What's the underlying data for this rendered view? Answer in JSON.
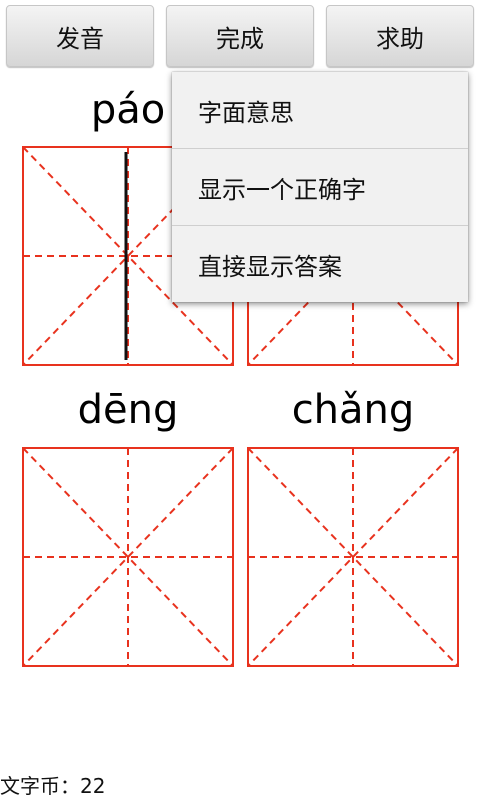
{
  "toolbar": {
    "pronounce_label": "发音",
    "done_label": "完成",
    "help_label": "求助"
  },
  "grid": {
    "cells": [
      {
        "pinyin": "páo"
      },
      {
        "pinyin": ""
      },
      {
        "pinyin": "dēng"
      },
      {
        "pinyin": "chǎng"
      }
    ],
    "guide_color": "#e8321e",
    "stroke_color": "#111111"
  },
  "help_menu": {
    "items": [
      {
        "label": "字面意思"
      },
      {
        "label": "显示一个正确字"
      },
      {
        "label": "直接显示答案"
      }
    ]
  },
  "status": {
    "coins_text": "文字币：22"
  }
}
